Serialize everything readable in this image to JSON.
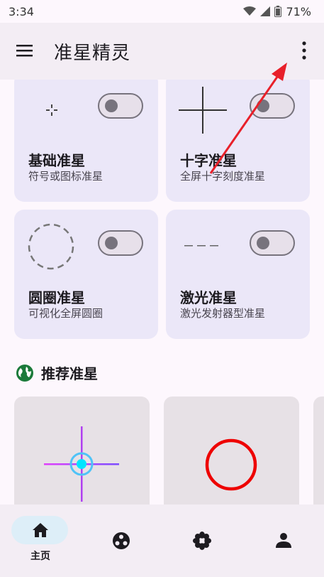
{
  "status_bar": {
    "time": "3:34",
    "battery": "71%",
    "icons": [
      "wifi-icon",
      "signal-icon",
      "battery-icon"
    ]
  },
  "app_bar": {
    "title": "准星精灵",
    "menu_icon": "hamburger-menu-icon",
    "more_icon": "more-vert-icon"
  },
  "crosshair_cards": [
    {
      "title": "基础准星",
      "subtitle": "符号或图标准星",
      "enabled": false
    },
    {
      "title": "十字准星",
      "subtitle": "全屏十字刻度准星",
      "enabled": false
    },
    {
      "title": "圆圈准星",
      "subtitle": "可视化全屏圆圈",
      "enabled": false
    },
    {
      "title": "激光准星",
      "subtitle": "激光发射器型准星",
      "enabled": false
    }
  ],
  "recommend_section": {
    "title": "推荐准星",
    "icon": "globe-icon"
  },
  "bottom_nav": {
    "items": [
      {
        "name": "home",
        "label": "主页",
        "icon": "home-icon",
        "active": true
      },
      {
        "name": "community",
        "icon": "dots-icon",
        "active": false
      },
      {
        "name": "settings",
        "icon": "flower-icon",
        "active": false
      },
      {
        "name": "profile",
        "icon": "person-icon",
        "active": false
      }
    ]
  },
  "colors": {
    "card_bg": "#ebe7f8",
    "accent_arrow": "#e8202a",
    "nav_pill": "#ddeef8"
  }
}
